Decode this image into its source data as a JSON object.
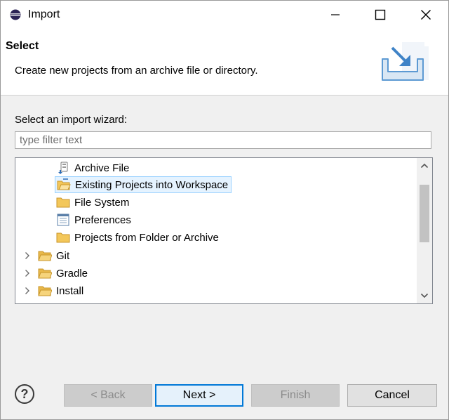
{
  "window": {
    "title": "Import",
    "icons": {
      "app": "eclipse-icon",
      "minimize": "minimize-icon",
      "maximize": "maximize-icon",
      "close": "close-icon"
    }
  },
  "header": {
    "title": "Select",
    "description": "Create new projects from an archive file or directory.",
    "icon": "import-wizard-icon"
  },
  "content": {
    "wizard_label": "Select an import wizard:",
    "filter_placeholder": "type filter text",
    "tree": {
      "items": [
        {
          "label": "Archive File",
          "icon": "archive-file-icon",
          "level": 1,
          "selected": false
        },
        {
          "label": "Existing Projects into Workspace",
          "icon": "existing-projects-icon",
          "level": 1,
          "selected": true
        },
        {
          "label": "File System",
          "icon": "folder-icon",
          "level": 1,
          "selected": false
        },
        {
          "label": "Preferences",
          "icon": "preferences-icon",
          "level": 1,
          "selected": false
        },
        {
          "label": "Projects from Folder or Archive",
          "icon": "folder-icon",
          "level": 1,
          "selected": false
        },
        {
          "label": "Git",
          "icon": "folder-open-icon",
          "level": 0,
          "expandable": true
        },
        {
          "label": "Gradle",
          "icon": "folder-open-icon",
          "level": 0,
          "expandable": true
        },
        {
          "label": "Install",
          "icon": "folder-open-icon",
          "level": 0,
          "expandable": true
        }
      ]
    }
  },
  "footer": {
    "help_icon": "help-icon",
    "back": "< Back",
    "next": "Next >",
    "finish": "Finish",
    "cancel": "Cancel"
  },
  "colors": {
    "selection_bg": "#e5f3ff",
    "selection_border": "#99d1ff",
    "primary_border": "#0078d7",
    "folder": "#f3c75a",
    "icon_blue": "#2f6db5"
  }
}
